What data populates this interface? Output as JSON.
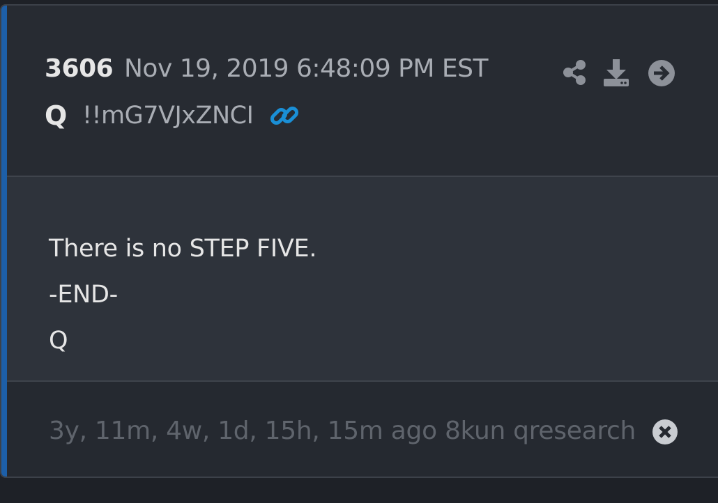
{
  "post": {
    "number": "3606",
    "datetime": "Nov 19, 2019 6:48:09 PM EST",
    "author": "Q",
    "tripcode": "!!mG7VJxZNCI",
    "body_lines": [
      "There is no STEP FIVE.",
      "-END-",
      "Q"
    ],
    "footer": "3y, 11m, 4w, 1d, 15h, 15m ago 8kun qresearch"
  },
  "icons": {
    "link": "link-icon",
    "share": "share-icon",
    "download": "download-icon",
    "open": "arrow-right-circle-icon",
    "close": "close-circle-icon"
  },
  "colors": {
    "accent_bar": "#1d5fa8",
    "link_icon": "#1a8fd6"
  }
}
